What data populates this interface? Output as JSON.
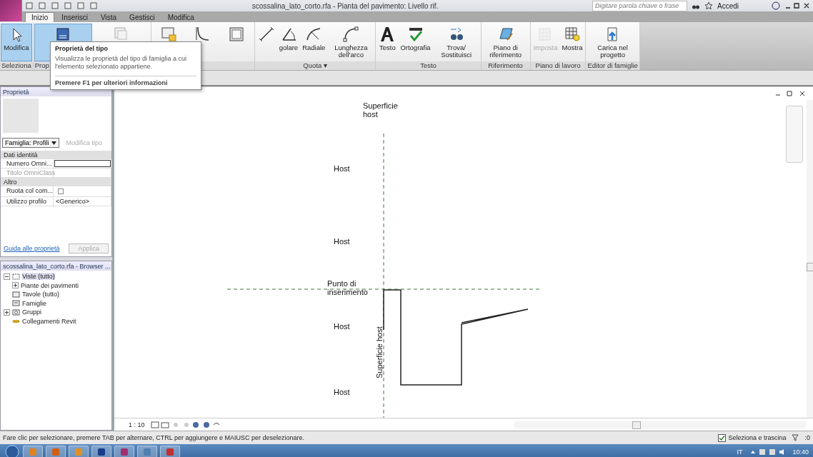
{
  "title_bar": {
    "title": "scossalina_lato_corto.rfa - Pianta del pavimento: Livello rif.",
    "search": {
      "placeholder": "Digitare parola chiave o frase"
    },
    "account": "Accedi"
  },
  "tabs": [
    {
      "label": "Inizio",
      "selected": true
    },
    {
      "label": "Inserisci",
      "selected": false
    },
    {
      "label": "Vista",
      "selected": false
    },
    {
      "label": "Gestisci",
      "selected": false
    },
    {
      "label": "Modifica",
      "selected": false
    }
  ],
  "ribbon_panels": [
    {
      "title": "Seleziona",
      "buttons": [
        {
          "label": "Modifica",
          "selected": true,
          "disabled": false
        }
      ]
    },
    {
      "title": "Prop",
      "buttons": [
        {
          "selected": true,
          "disabled": false
        },
        {
          "selected": false,
          "disabled": false
        }
      ]
    },
    {
      "buttons": [
        {
          "selected": false,
          "disabled": false
        },
        {
          "selected": false,
          "disabled": false
        },
        {
          "selected": false,
          "disabled": false
        }
      ]
    },
    {
      "title": "Quota ▾",
      "buttons": [
        {
          "selected": false,
          "disabled": false
        },
        {
          "label": "golare",
          "selected": false,
          "disabled": false
        },
        {
          "label": "Radiale",
          "selected": false,
          "disabled": false
        },
        {
          "label": "Lunghezza dell'arco",
          "selected": false,
          "disabled": false
        }
      ]
    },
    {
      "title": "Testo",
      "buttons": [
        {
          "label": "Testo",
          "selected": false,
          "disabled": false
        },
        {
          "label": "Ortografia",
          "selected": false,
          "disabled": false
        },
        {
          "label": "Trova/ Sostituisci",
          "selected": false,
          "disabled": false
        }
      ]
    },
    {
      "title": "Riferimento",
      "buttons": [
        {
          "label": "Piano di riferimento",
          "selected": false,
          "disabled": false
        }
      ]
    },
    {
      "title": "Piano di lavoro",
      "buttons": [
        {
          "label": "Imposta",
          "selected": false,
          "disabled": true
        },
        {
          "label": "Mostra",
          "selected": false,
          "disabled": false
        }
      ]
    },
    {
      "title": "Editor di famiglie",
      "buttons": [
        {
          "label": "Carica nel progetto",
          "selected": false,
          "disabled": false
        }
      ]
    }
  ],
  "tooltip": {
    "title": "Proprietà del tipo",
    "body": "Visualizza le proprietà del tipo di famiglia a cui l'elemento selezionato appartiene.",
    "footer": "Premere F1 per ulteriori informazioni"
  },
  "properties": {
    "title": "Proprietà",
    "type_selector": "Famiglia: Profili",
    "edit_type": {
      "label": "Modifica tipo",
      "disabled": true
    },
    "groups": [
      {
        "name": "Dati identità",
        "rows": [
          {
            "kind": "field",
            "label": "Numero Omni...",
            "disabled": false
          },
          {
            "kind": "text",
            "label": "Titolo OmniClass",
            "disabled": true
          }
        ]
      },
      {
        "name": "Altro",
        "rows": [
          {
            "kind": "checkbox",
            "label": "Ruota col com...",
            "checked": false,
            "disabled": false
          },
          {
            "kind": "text",
            "label": "Utilizzo profilo",
            "value": "<Generico>",
            "disabled": false
          }
        ]
      }
    ],
    "help_link": "Guida alle proprietà",
    "apply": {
      "label": "Applica",
      "disabled": true
    }
  },
  "project_browser": {
    "title": "scossalina_lato_corto.rfa - Browser ...",
    "tree": [
      {
        "label": "Viste (tutto)",
        "selected": true,
        "expanded": true,
        "children": [
          {
            "label": "Piante dei pavimenti",
            "selected": false,
            "expanded": false
          }
        ]
      },
      {
        "label": "Tavole (tutto)",
        "selected": false
      },
      {
        "label": "Famiglie",
        "selected": false
      },
      {
        "label": "Gruppi",
        "selected": false,
        "expanded": false
      },
      {
        "label": "Collegamenti Revit",
        "selected": false
      }
    ]
  },
  "canvas": {
    "labels": [
      {
        "kind": "plain",
        "text": "Superficie host"
      },
      {
        "kind": "plain",
        "text": "Host"
      },
      {
        "kind": "plain",
        "text": "Host"
      },
      {
        "kind": "plain",
        "text": "Punto di inserimento"
      },
      {
        "kind": "plain",
        "text": "Host"
      },
      {
        "kind": "vertical",
        "text": "Superficie host"
      },
      {
        "kind": "plain",
        "text": "Host"
      }
    ],
    "view_bar": {
      "scale": "1 : 10"
    }
  },
  "status_bar": {
    "message": "Fare clic per selezionare, premere TAB per alternare, CTRL per aggiungere e MAIUSC per deselezionare.",
    "select_drag": {
      "label": "Seleziona e trascina",
      "checked": true
    },
    "filter_count": ":0"
  },
  "taskbar": {
    "language": "IT",
    "time": "10:40"
  }
}
